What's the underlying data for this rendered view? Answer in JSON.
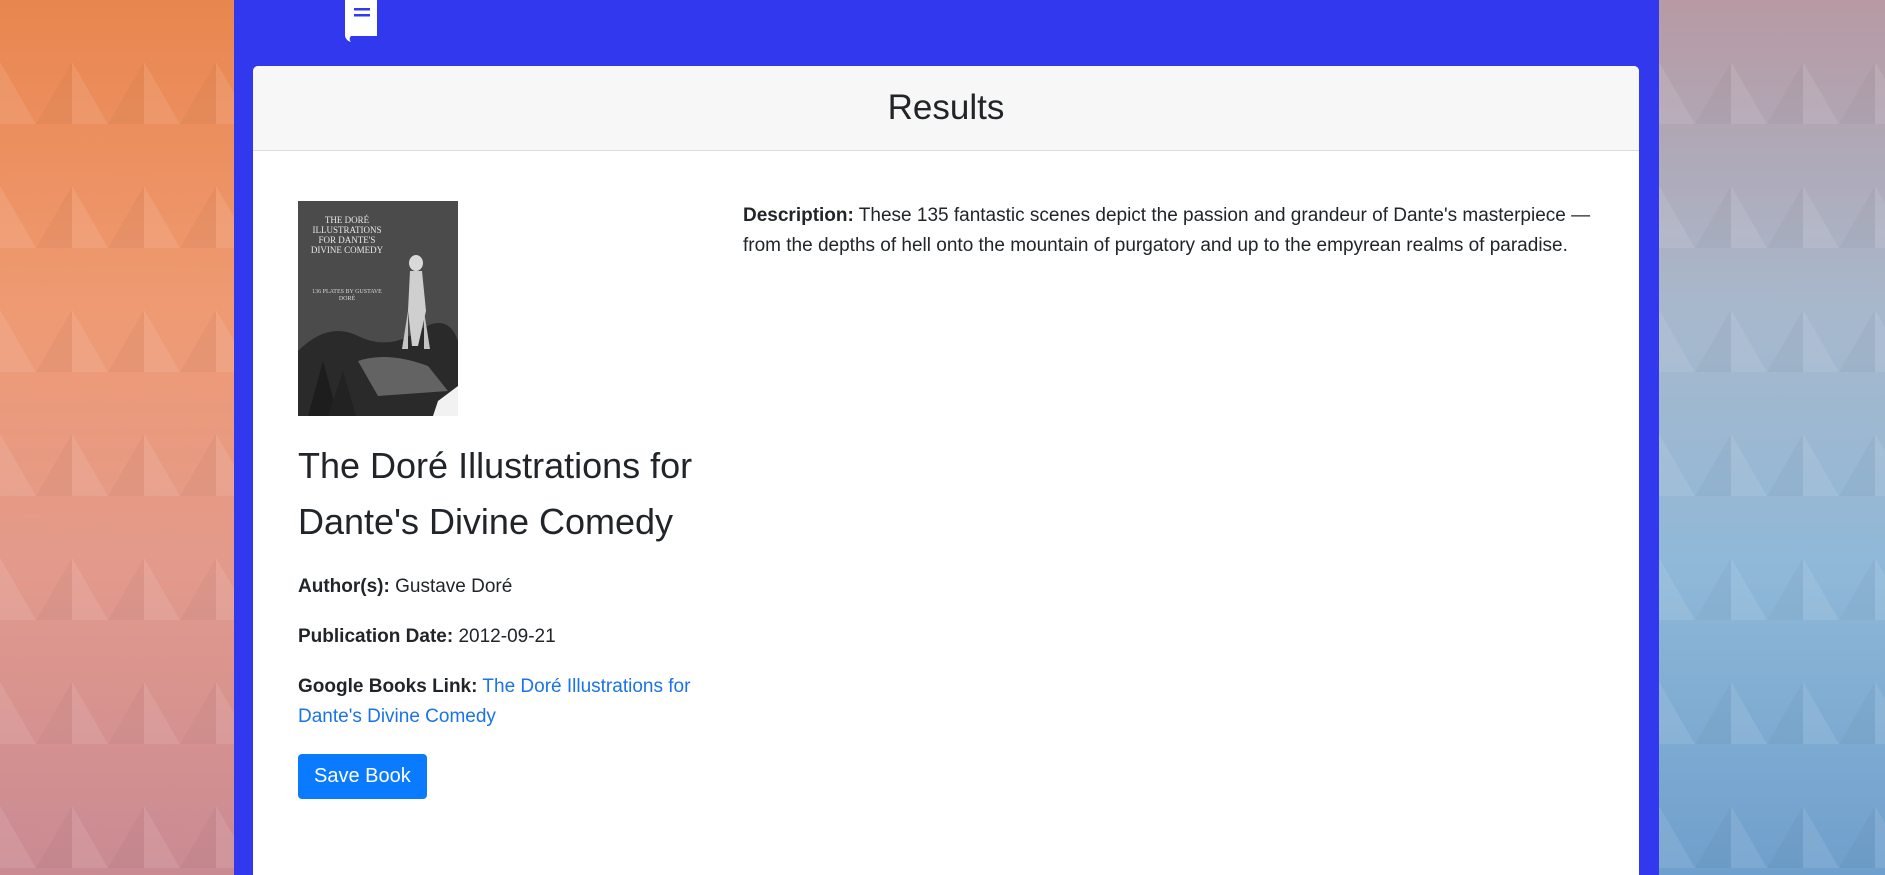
{
  "header": {
    "title": "Results"
  },
  "book": {
    "title": "The Doré Illustrations for Dante's Divine Comedy",
    "cover_title": "THE DORÉ ILLUSTRATIONS FOR DANTE'S DIVINE COMEDY",
    "cover_subtitle": "136 PLATES BY GUSTAVE DORÉ",
    "authors_label": "Author(s):",
    "authors": "Gustave Doré",
    "publication_label": "Publication Date:",
    "publication_date": "2012-09-21",
    "link_label": "Google Books Link:",
    "link_text": "The Doré Illustrations for Dante's Divine Comedy",
    "save_button": "Save Book",
    "description_label": "Description:",
    "description": "These 135 fantastic scenes depict the passion and grandeur of Dante's masterpiece — from the depths of hell onto the mountain of purgatory and up to the empyrean realms of paradise."
  },
  "colors": {
    "nav_background": "#3138ee",
    "button": "#0a7bff",
    "link": "#1a73e8"
  },
  "icons": {
    "brand": "book-icon"
  }
}
